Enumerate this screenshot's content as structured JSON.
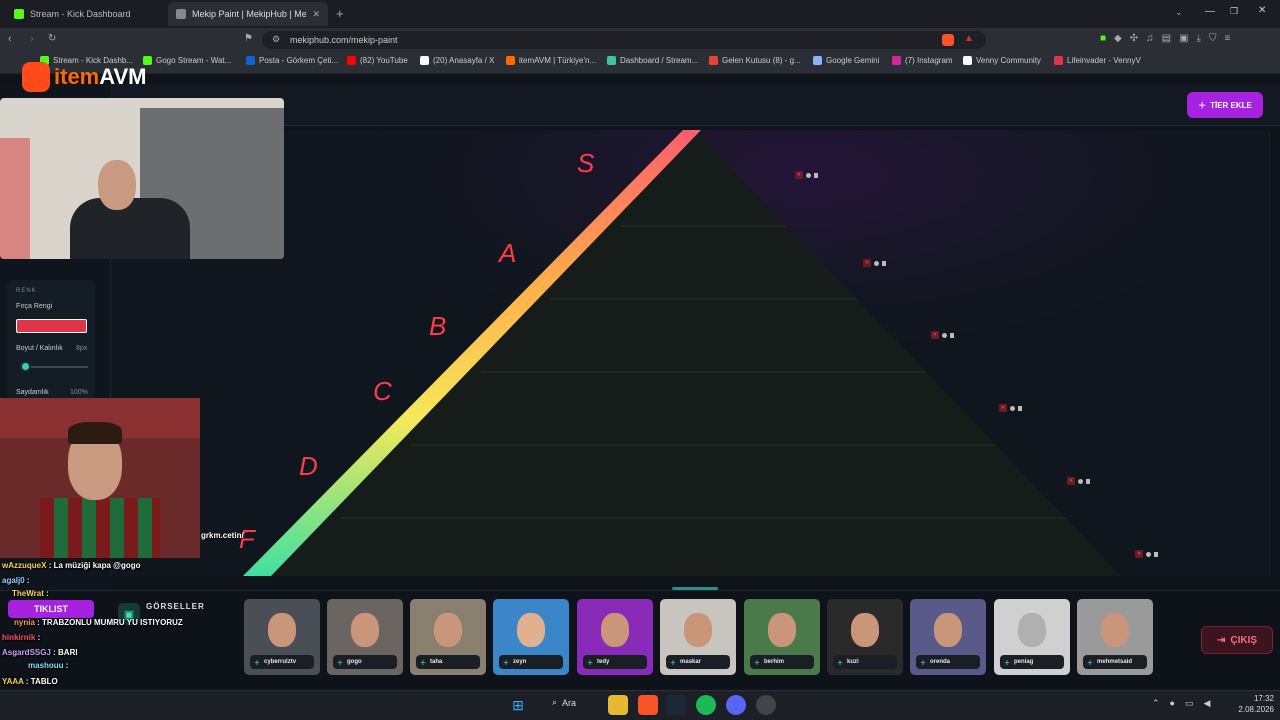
{
  "browser": {
    "tabs": [
      {
        "label": "Stream - Kick Dashboard",
        "color": "#53fc18"
      },
      {
        "label": "Mekip Paint | MekipHub | Mekip",
        "color": "#888888"
      }
    ],
    "url": "mekiphub.com/mekip-paint",
    "bookmarks": [
      {
        "label": "Stream - Kick Dashb...",
        "color": "#53fc18"
      },
      {
        "label": "Gogo Stream - Wat...",
        "color": "#53fc18"
      },
      {
        "label": "Posta - Görkem Çeti...",
        "color": "#0a64d8"
      },
      {
        "label": "(82) YouTube",
        "color": "#ff0000"
      },
      {
        "label": "(20) Anasayfa / X",
        "color": "#ffffff"
      },
      {
        "label": "itemAVM | Türkiye'n...",
        "color": "#ff6a00"
      },
      {
        "label": "Dashboard / Stream...",
        "color": "#3fc3a0"
      },
      {
        "label": "Gelen Kutusu (8) - g...",
        "color": "#ea4335"
      },
      {
        "label": "Google Gemini",
        "color": "#8ab4f8"
      },
      {
        "label": "(7) Instagram",
        "color": "#d6249f"
      },
      {
        "label": "Venny Community",
        "color": "#ffffff"
      },
      {
        "label": "Lifeinvader - VennyV",
        "color": "#e0344a"
      }
    ]
  },
  "overlay": {
    "logo_prefix": "item",
    "logo_suffix": "AVM",
    "cam_caption": "grkm.cetin/"
  },
  "header": {
    "add_tier_label": "TİER EKLE"
  },
  "left_panel": {
    "section_title": "RENK",
    "brush_color_label": "Fırça Rengi",
    "brush_color": "#e0344a",
    "size_label": "Boyut / Kalınlık",
    "size_value": "8px",
    "opacity_label": "Saydamlık",
    "opacity_value": "100%"
  },
  "tiers": [
    {
      "letter": "S",
      "color": "#ff5d6c"
    },
    {
      "letter": "A",
      "color": "#ff9a4a"
    },
    {
      "letter": "B",
      "color": "#ffc04a"
    },
    {
      "letter": "C",
      "color": "#f5e85a"
    },
    {
      "letter": "D",
      "color": "#8fe05a"
    },
    {
      "letter": "F",
      "color": "#3fe0a0"
    }
  ],
  "gallery": {
    "title": "GÖRSELLER",
    "items": [
      "cyberrulztv",
      "gogo",
      "taha",
      "zeyn",
      "tedy",
      "maskar",
      "berhim",
      "kuzi",
      "orenda",
      "peniag",
      "mehmetsaid"
    ],
    "exit_label": "ÇIKIŞ"
  },
  "chat": [
    {
      "user": "wAzzuqueX",
      "text": ": La müziği kapa @gogo",
      "color": "#ffd24a"
    },
    {
      "user": "agalj0",
      "text": ":",
      "color": "#9ad0ff"
    },
    {
      "user": "TheWrat",
      "text": ":",
      "color": "#ffd24a"
    },
    {
      "user": "TIKLIST",
      "text": "",
      "color": "#ffffff"
    },
    {
      "user": "nynia",
      "text": ": TRABZONLU MUMRU YU ISTIYORUZ",
      "color": "#ff9a4a"
    },
    {
      "user": "hinkirnik",
      "text": ":",
      "color": "#ff4a6a"
    },
    {
      "user": "AsgardSSGJ",
      "text": ": BARI",
      "color": "#c8a0ff"
    },
    {
      "user": "mashouu",
      "text": ":",
      "color": "#8ad8ff"
    },
    {
      "user": "YAAA",
      "text": ": TABLO",
      "color": "#ffd24a"
    }
  ],
  "taskbar": {
    "search_label": "Ara",
    "time": "17:32",
    "date": "2.08.2026"
  }
}
